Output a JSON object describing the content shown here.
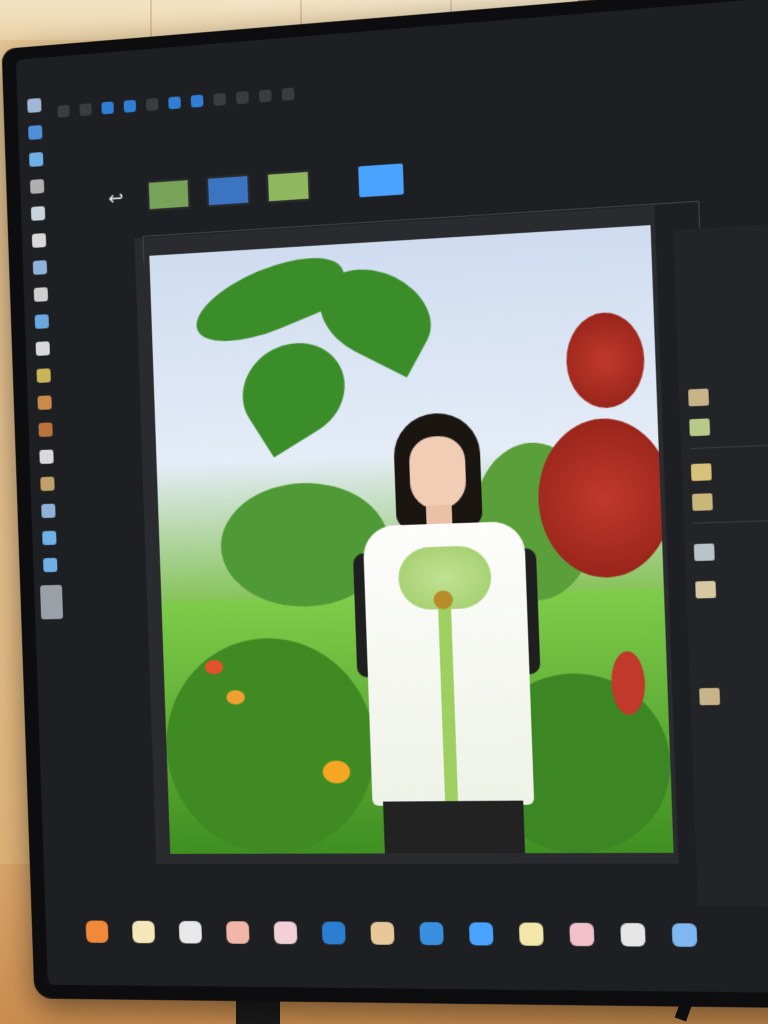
{
  "app": {
    "menu": [
      "",
      "",
      "",
      "",
      "",
      "",
      "",
      "",
      "",
      ""
    ],
    "status_labels": [
      "",
      "",
      "",
      "",
      "",
      ""
    ]
  },
  "toolbar": {
    "option_icons": [
      "move-icon",
      "select-icon",
      "lasso-icon",
      "brush-icon",
      "eraser-icon",
      "stamp-icon",
      "gradient-icon",
      "text-icon",
      "shape-icon",
      "hand-icon",
      "zoom-icon"
    ]
  },
  "thumbnails": [
    {
      "name": "thumbnail-1",
      "color": "#7aa35a",
      "selected": false
    },
    {
      "name": "thumbnail-2",
      "color": "#3c74c4",
      "selected": false
    },
    {
      "name": "thumbnail-3",
      "color": "#8fb85f",
      "selected": false
    },
    {
      "name": "thumbnail-4",
      "color": "#4aa3ff",
      "selected": true
    }
  ],
  "canvas": {
    "subject": "woman-in-garden-photo"
  },
  "colors": {
    "accent": "#4aa3ff",
    "panel": "#232427",
    "background": "#1e1f22"
  }
}
